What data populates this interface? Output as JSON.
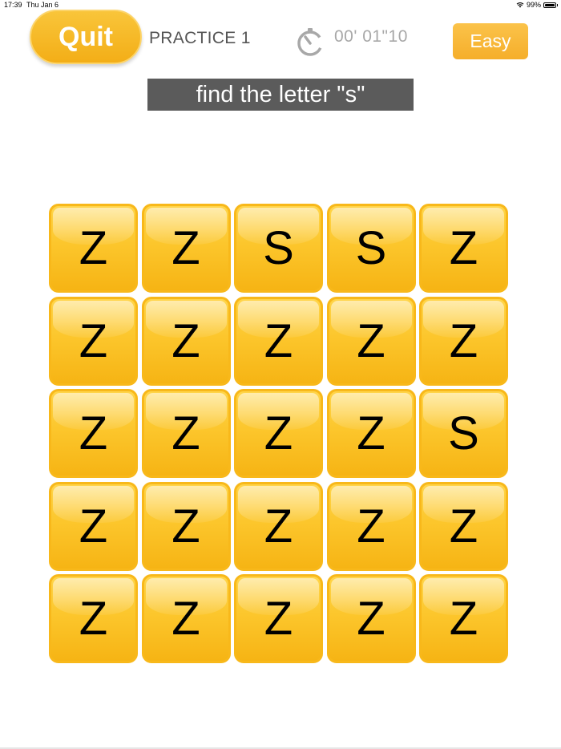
{
  "status_bar": {
    "time": "17:39",
    "date": "Thu Jan 6",
    "battery": "99%",
    "battery_level": 0.99,
    "wifi_icon": "wifi-icon",
    "battery_icon": "battery-icon"
  },
  "header": {
    "quit_label": "Quit",
    "practice_label": "PRACTICE 1",
    "timer_icon": "stopwatch-icon",
    "timer_value": "00' 01\"10",
    "level_label": "Easy"
  },
  "instruction": "find the letter \"s\"",
  "colors": {
    "tile": "#fcc62c",
    "tile_border": "#f8b81a",
    "quit_button": "#f5b11e",
    "level_button": "#f7b33a",
    "banner": "#5b5b5b",
    "timer_text": "#a8a8a8"
  },
  "grid": {
    "rows": [
      [
        "Z",
        "Z",
        "S",
        "S",
        "Z"
      ],
      [
        "Z",
        "Z",
        "Z",
        "Z",
        "Z"
      ],
      [
        "Z",
        "Z",
        "Z",
        "Z",
        "S"
      ],
      [
        "Z",
        "Z",
        "Z",
        "Z",
        "Z"
      ],
      [
        "Z",
        "Z",
        "Z",
        "Z",
        "Z"
      ]
    ]
  }
}
